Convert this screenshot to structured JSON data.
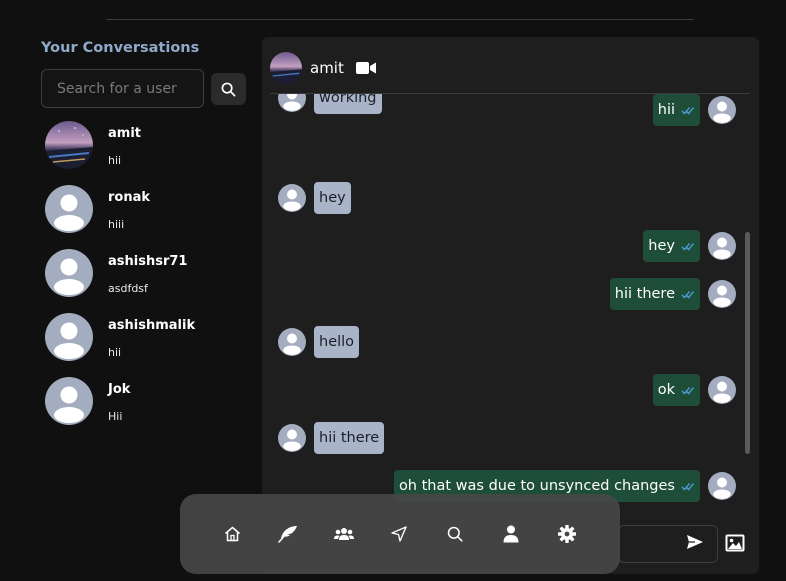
{
  "sidebar": {
    "title": "Your Conversations",
    "search_placeholder": "Search for a user",
    "conversations": [
      {
        "name": "amit",
        "last_message": "hii",
        "avatar": "photo"
      },
      {
        "name": "ronak",
        "last_message": "hiii",
        "avatar": "default"
      },
      {
        "name": "ashishsr71",
        "last_message": "asdfdsf",
        "avatar": "default"
      },
      {
        "name": "ashishmalik",
        "last_message": "hii",
        "avatar": "default"
      },
      {
        "name": "Jok",
        "last_message": "Hii",
        "avatar": "default"
      }
    ]
  },
  "chat": {
    "contact_name": "amit",
    "messages": [
      {
        "text": "working",
        "direction": "in"
      },
      {
        "text": "hii",
        "direction": "out",
        "status": "read"
      },
      {
        "text": "hey",
        "direction": "in"
      },
      {
        "text": "hey",
        "direction": "out",
        "status": "read"
      },
      {
        "text": "hii there",
        "direction": "out",
        "status": "read"
      },
      {
        "text": "hello",
        "direction": "in"
      },
      {
        "text": "ok",
        "direction": "out",
        "status": "read"
      },
      {
        "text": "hii there",
        "direction": "in"
      },
      {
        "text": "oh that was due to unsynced changes",
        "direction": "out",
        "status": "read"
      }
    ],
    "composer_value": ""
  },
  "bottom_nav": [
    "home-icon",
    "feather-icon",
    "users-icon",
    "send-nav-icon",
    "search-nav-icon",
    "profile-icon",
    "settings-icon"
  ],
  "colors": {
    "background": "#101010",
    "panel": "#1e1e1e",
    "incoming_bubble": "#a9b4c8",
    "outgoing_bubble": "#1e4d3a",
    "read_ticks": "#4fa3d8",
    "sidebar_title": "#8fa9c9"
  }
}
